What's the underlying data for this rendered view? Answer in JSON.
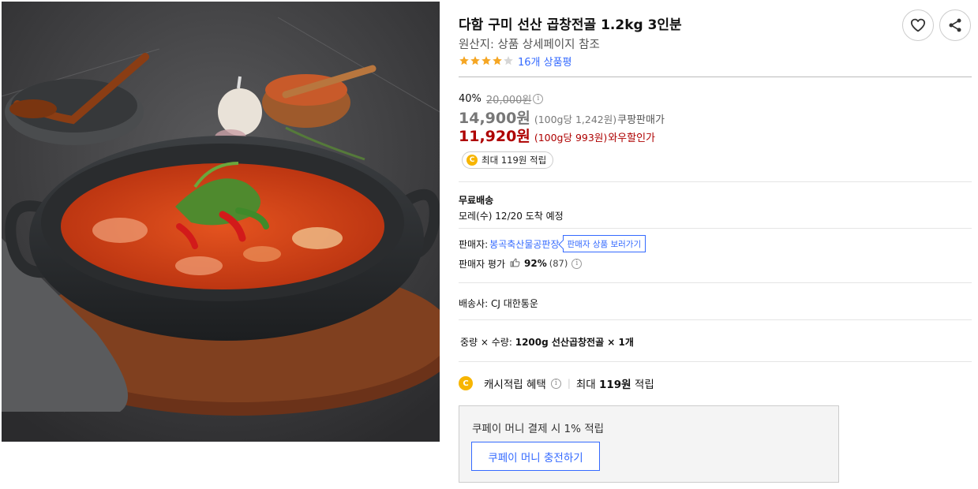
{
  "product": {
    "title": "다함 구미 선산 곱창전골 1.2kg 3인분",
    "origin": "원산지: 상품 상세페이지 참조",
    "rating_value": 4,
    "rating_max": 5,
    "review_count": "16개 상품평",
    "image_alt": "곱창전골 상품 이미지"
  },
  "price": {
    "discount_rate": "40%",
    "original": "20,000원",
    "info_glyph": "i",
    "normal_price": "14,900원",
    "normal_unit": "(100g당 1,242원)",
    "normal_type": "쿠팡판매가",
    "wow_price": "11,920원",
    "wow_unit": "(100g당 993원)",
    "wow_type": "와우할인가",
    "cash_pill": "최대 119원 적립",
    "coin_glyph": "C"
  },
  "shipping": {
    "title": "무료배송",
    "date": "모레(수) 12/20 도착 예정"
  },
  "seller": {
    "label": "판매자:",
    "name": "봉곡축산물공판장",
    "shop_button": "판매자 상품 보러가기",
    "rating_label": "판매자 평가",
    "thumb_glyph": "👍",
    "rating_pct": "92%",
    "rating_count": "(87)"
  },
  "carrier": "배송사: CJ 대한통운",
  "option": {
    "label": "중량 × 수량:",
    "value": "1200g 선산곱창전골 × 1개"
  },
  "cash_benefit": {
    "label": "캐시적립 혜택",
    "separator": "|",
    "prefix": "최대",
    "amount": "119원",
    "suffix": "적립"
  },
  "coupay": {
    "text": "쿠페이 머니 결제 시 1% 적립",
    "button": "쿠페이 머니 충전하기"
  },
  "colors": {
    "accent_blue": "#346aff",
    "wow_red": "#ae0000",
    "star": "#f5a623",
    "coin": "#f7b500"
  },
  "icons": {
    "favorite": "heart-icon",
    "share": "share-icon",
    "info": "info-icon",
    "thumb": "thumbs-up-icon",
    "coin": "cash-coin-icon"
  }
}
